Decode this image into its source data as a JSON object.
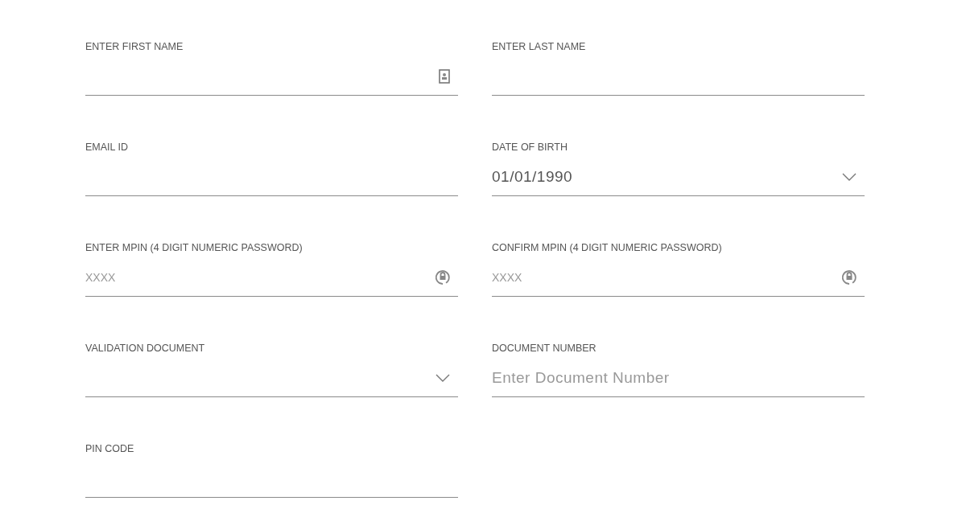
{
  "fields": [
    {
      "label": "ENTER FIRST NAME",
      "kind": "contact"
    },
    {
      "label": "ENTER LAST NAME",
      "kind": "text"
    },
    {
      "label": "EMAIL ID",
      "kind": "text"
    },
    {
      "label": "DATE OF BIRTH",
      "kind": "select",
      "value": "01/01/1990"
    },
    {
      "label": "ENTER MPIN (4 DIGIT NUMERIC PASSWORD)",
      "kind": "password",
      "placeholder": "XXXX"
    },
    {
      "label": "CONFIRM MPIN (4 DIGIT NUMERIC PASSWORD)",
      "kind": "password",
      "placeholder": "XXXX"
    },
    {
      "label": "VALIDATION DOCUMENT",
      "kind": "select"
    },
    {
      "label": "DOCUMENT NUMBER",
      "kind": "text",
      "placeholder": "Enter Document Number"
    },
    {
      "label": "PIN CODE",
      "kind": "text"
    }
  ]
}
